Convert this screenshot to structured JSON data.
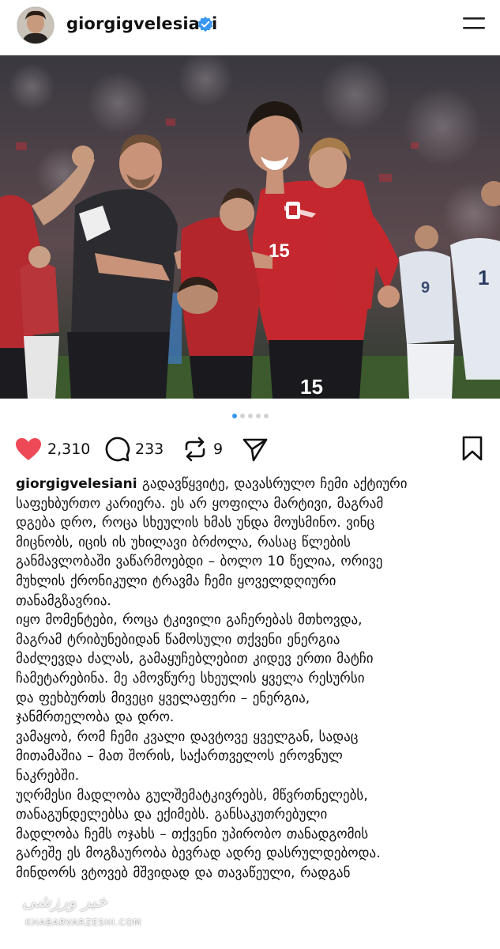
{
  "header": {
    "username": "giorgigvelesiani",
    "verified_color": "#3897f0"
  },
  "post": {
    "image_alt_icon": "photo-georgian-football-team-celebration",
    "carousel": {
      "count": 5,
      "active_index": 0
    }
  },
  "actions": {
    "likes": "2,310",
    "comments": "233",
    "reposts": "9",
    "like_color": "#ed4956"
  },
  "caption": {
    "username": "giorgigvelesiani",
    "first_line": "გადავწყვიტე, დავასრულო ჩემი აქტიური",
    "lines": [
      "საფეხბურთო კარიერა. ეს არ ყოფილა მარტივი, მაგრამ",
      "დგება დრო, როცა სხეულის ხმას უნდა მოუსმინო. ვინც",
      "მიცნობს, იცის ის უხილავი ბრძოლა, რასაც წლების",
      "განმავლობაში ვაწარმოებდი – ბოლო 10 წელია, ორივე",
      "მუხლის ქრონიკული ტრავმა ჩემი ყოველდღიური",
      "თანამგზავრია.",
      "იყო მომენტები, როცა ტკივილი გაჩერებას მთხოვდა,",
      "მაგრამ ტრიბუნებიდან წამოსული თქვენი ენერგია",
      "მაძლევდა ძალას, გამაყუჩებლებით კიდევ ერთი მატჩი",
      "ჩამეტარებინა. მე ამოვწურე სხეულის ყველა რესურსი",
      "და ფეხბურთს მივეცი ყველაფერი – ენერგია,",
      "ჯანმრთელობა და დრო.",
      "ვამაყობ, რომ ჩემი კვალი დავტოვე ყველგან, სადაც",
      "მითამაშია – მათ შორის, საქართველოს ეროვნულ",
      "ნაკრებში.",
      "უღრმესი მადლობა გულშემატკივრებს, მწვრთნელებს,",
      "თანაგუნდელებსა და ექიმებს. განსაკუთრებული",
      "მადლობა ჩემს ოჯახს – თქვენი უპირობო თანადგომის",
      "გარეშე ეს მოგზაურობა ბევრად ადრე დასრულდებოდა.",
      "მინდორს ვტოვებ მშვიდად და თავაწეული, რადგან"
    ]
  },
  "watermark": {
    "title": "خبر ورزشی",
    "site": "KHABARVARZESHI.COM"
  }
}
